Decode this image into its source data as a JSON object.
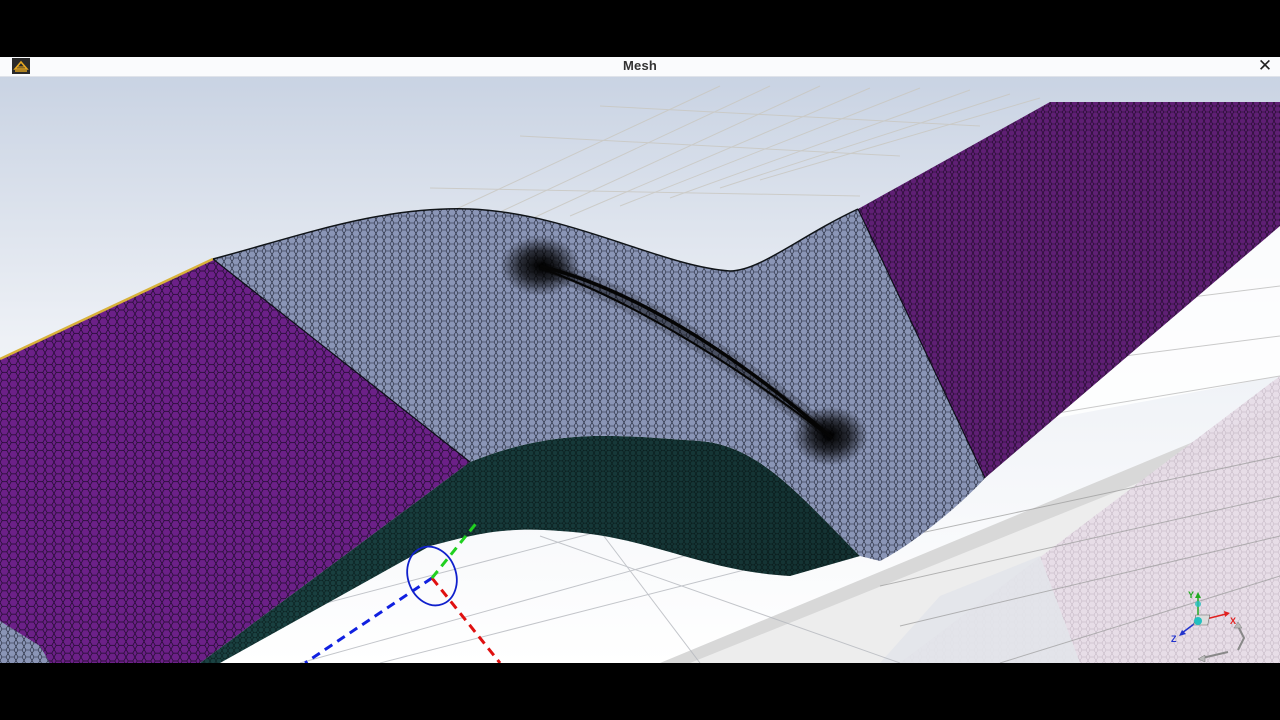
{
  "window": {
    "title": "Mesh",
    "close_glyph": "✕",
    "app_icon": "ansys-app-icon"
  },
  "viewport": {
    "content": "polyhedral-mesh-of-channel-with-airfoil",
    "background_gradient": [
      "#c9d3e3",
      "#ffffff"
    ],
    "colors": {
      "inlet_outlet_zone": "#6a1e86",
      "outlet_zone": "#5e1e72",
      "channel_top_zone": "#8792b4",
      "channel_side_zone": "#163a3a",
      "airfoil_edges": "#0a0a0a",
      "mesh_lines": "#101010"
    }
  },
  "triad": {
    "axis_x_label": "X",
    "axis_y_label": "Y",
    "axis_z_label": "Z",
    "colors": {
      "x": "#e02020",
      "y": "#22aa22",
      "z": "#2233cc",
      "origin": "#22c0c0"
    }
  },
  "origin_marker": {
    "colors": {
      "x": "#e01010",
      "y": "#20d020",
      "z": "#1020e0",
      "circle": "#1020cc"
    }
  }
}
